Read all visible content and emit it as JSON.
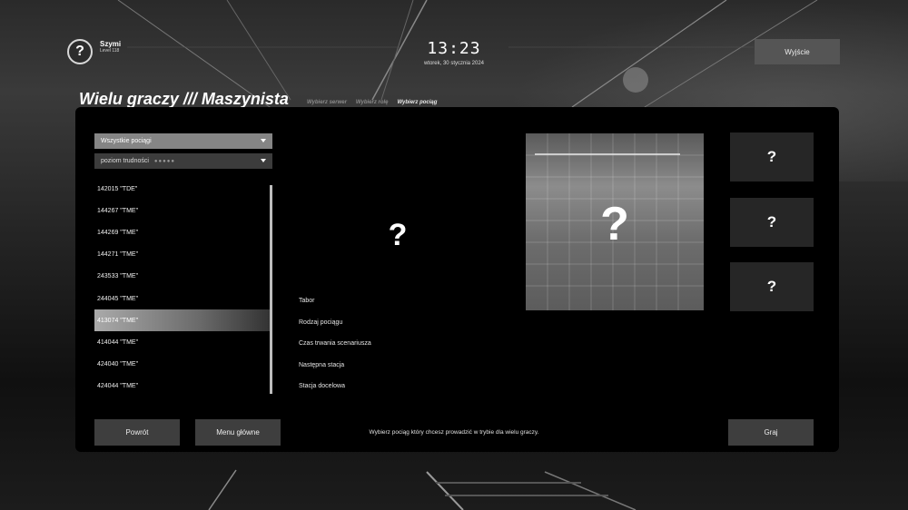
{
  "user": {
    "name": "Szymi",
    "level": "Level 118"
  },
  "clock": {
    "time": "13:23",
    "date": "wtorek, 30 stycznia 2024"
  },
  "header": {
    "exit_label": "Wyjście",
    "title": "Wielu graczy /// Maszynista"
  },
  "steps": [
    {
      "label": "Wybierz serwer",
      "active": false
    },
    {
      "label": "Wybierz rolę",
      "active": false
    },
    {
      "label": "Wybierz pociąg",
      "active": true
    }
  ],
  "filters": {
    "train_filter": "Wszystkie pociągi",
    "difficulty_label": "poziom trudności",
    "difficulty_dots": "●●●●●"
  },
  "trains": [
    {
      "label": "142015 \"TDE\"",
      "selected": false
    },
    {
      "label": "144267 \"TME\"",
      "selected": false
    },
    {
      "label": "144269 \"TME\"",
      "selected": false
    },
    {
      "label": "144271 \"TME\"",
      "selected": false
    },
    {
      "label": "243533 \"TME\"",
      "selected": false
    },
    {
      "label": "244045 \"TME\"",
      "selected": false
    },
    {
      "label": "413074 \"TME\"",
      "selected": true
    },
    {
      "label": "414044 \"TME\"",
      "selected": false
    },
    {
      "label": "424040 \"TME\"",
      "selected": false
    },
    {
      "label": "424044 \"TME\"",
      "selected": false
    }
  ],
  "details": {
    "placeholder": "?",
    "labels": [
      "Tabor",
      "Rodzaj pociągu",
      "Czas trwania scenariusza",
      "Następna stacja",
      "Stacja docelowa"
    ]
  },
  "preview": {
    "placeholder": "?"
  },
  "thumbnails": [
    "?",
    "?",
    "?"
  ],
  "footer": {
    "back_label": "Powrót",
    "menu_label": "Menu główne",
    "hint": "Wybierz pociąg który chcesz prowadzić w trybie dla wielu graczy.",
    "play_label": "Graj"
  }
}
